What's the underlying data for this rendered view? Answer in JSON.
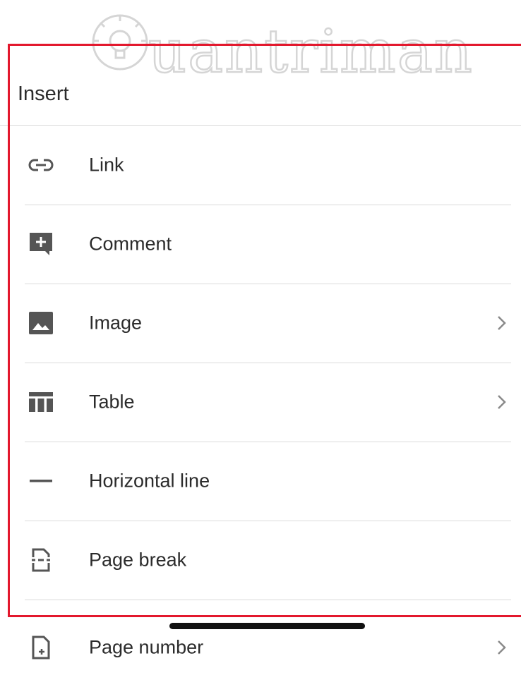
{
  "watermark": {
    "text": "Quantrimang"
  },
  "menu": {
    "title": "Insert",
    "items": [
      {
        "label": "Link",
        "icon": "link-icon",
        "has_submenu": false
      },
      {
        "label": "Comment",
        "icon": "add-comment-icon",
        "has_submenu": false
      },
      {
        "label": "Image",
        "icon": "image-icon",
        "has_submenu": true
      },
      {
        "label": "Table",
        "icon": "table-icon",
        "has_submenu": true
      },
      {
        "label": "Horizontal line",
        "icon": "horizontal-line-icon",
        "has_submenu": false
      },
      {
        "label": "Page break",
        "icon": "page-break-icon",
        "has_submenu": false
      },
      {
        "label": "Page number",
        "icon": "page-number-icon",
        "has_submenu": true
      }
    ]
  },
  "colors": {
    "highlight_frame": "#e3182d",
    "icon": "#555555",
    "text": "#2b2b2b",
    "divider": "#dadada"
  }
}
